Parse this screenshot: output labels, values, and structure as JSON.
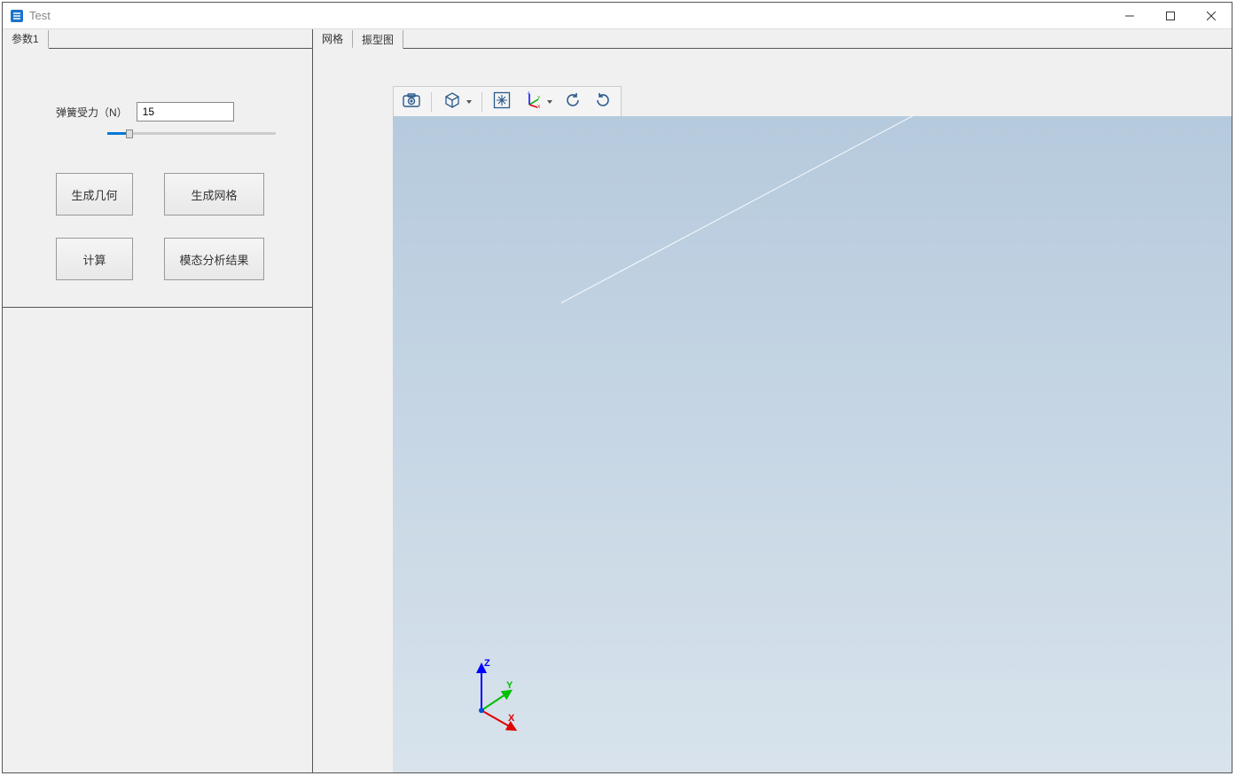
{
  "window": {
    "title": "Test"
  },
  "left_panel": {
    "tabs": [
      {
        "label": "参数1"
      }
    ],
    "params": {
      "spring_force": {
        "label": "弹簧受力（N）",
        "value": "15"
      }
    },
    "buttons": {
      "generate_geometry": "生成几何",
      "generate_mesh": "生成网格",
      "compute": "计算",
      "modal_result": "模态分析结果"
    }
  },
  "right_panel": {
    "tabs": [
      {
        "label": "网格",
        "active": true
      },
      {
        "label": "振型图",
        "active": false
      }
    ],
    "triad": {
      "x_label": "X",
      "y_label": "Y",
      "z_label": "Z"
    }
  }
}
